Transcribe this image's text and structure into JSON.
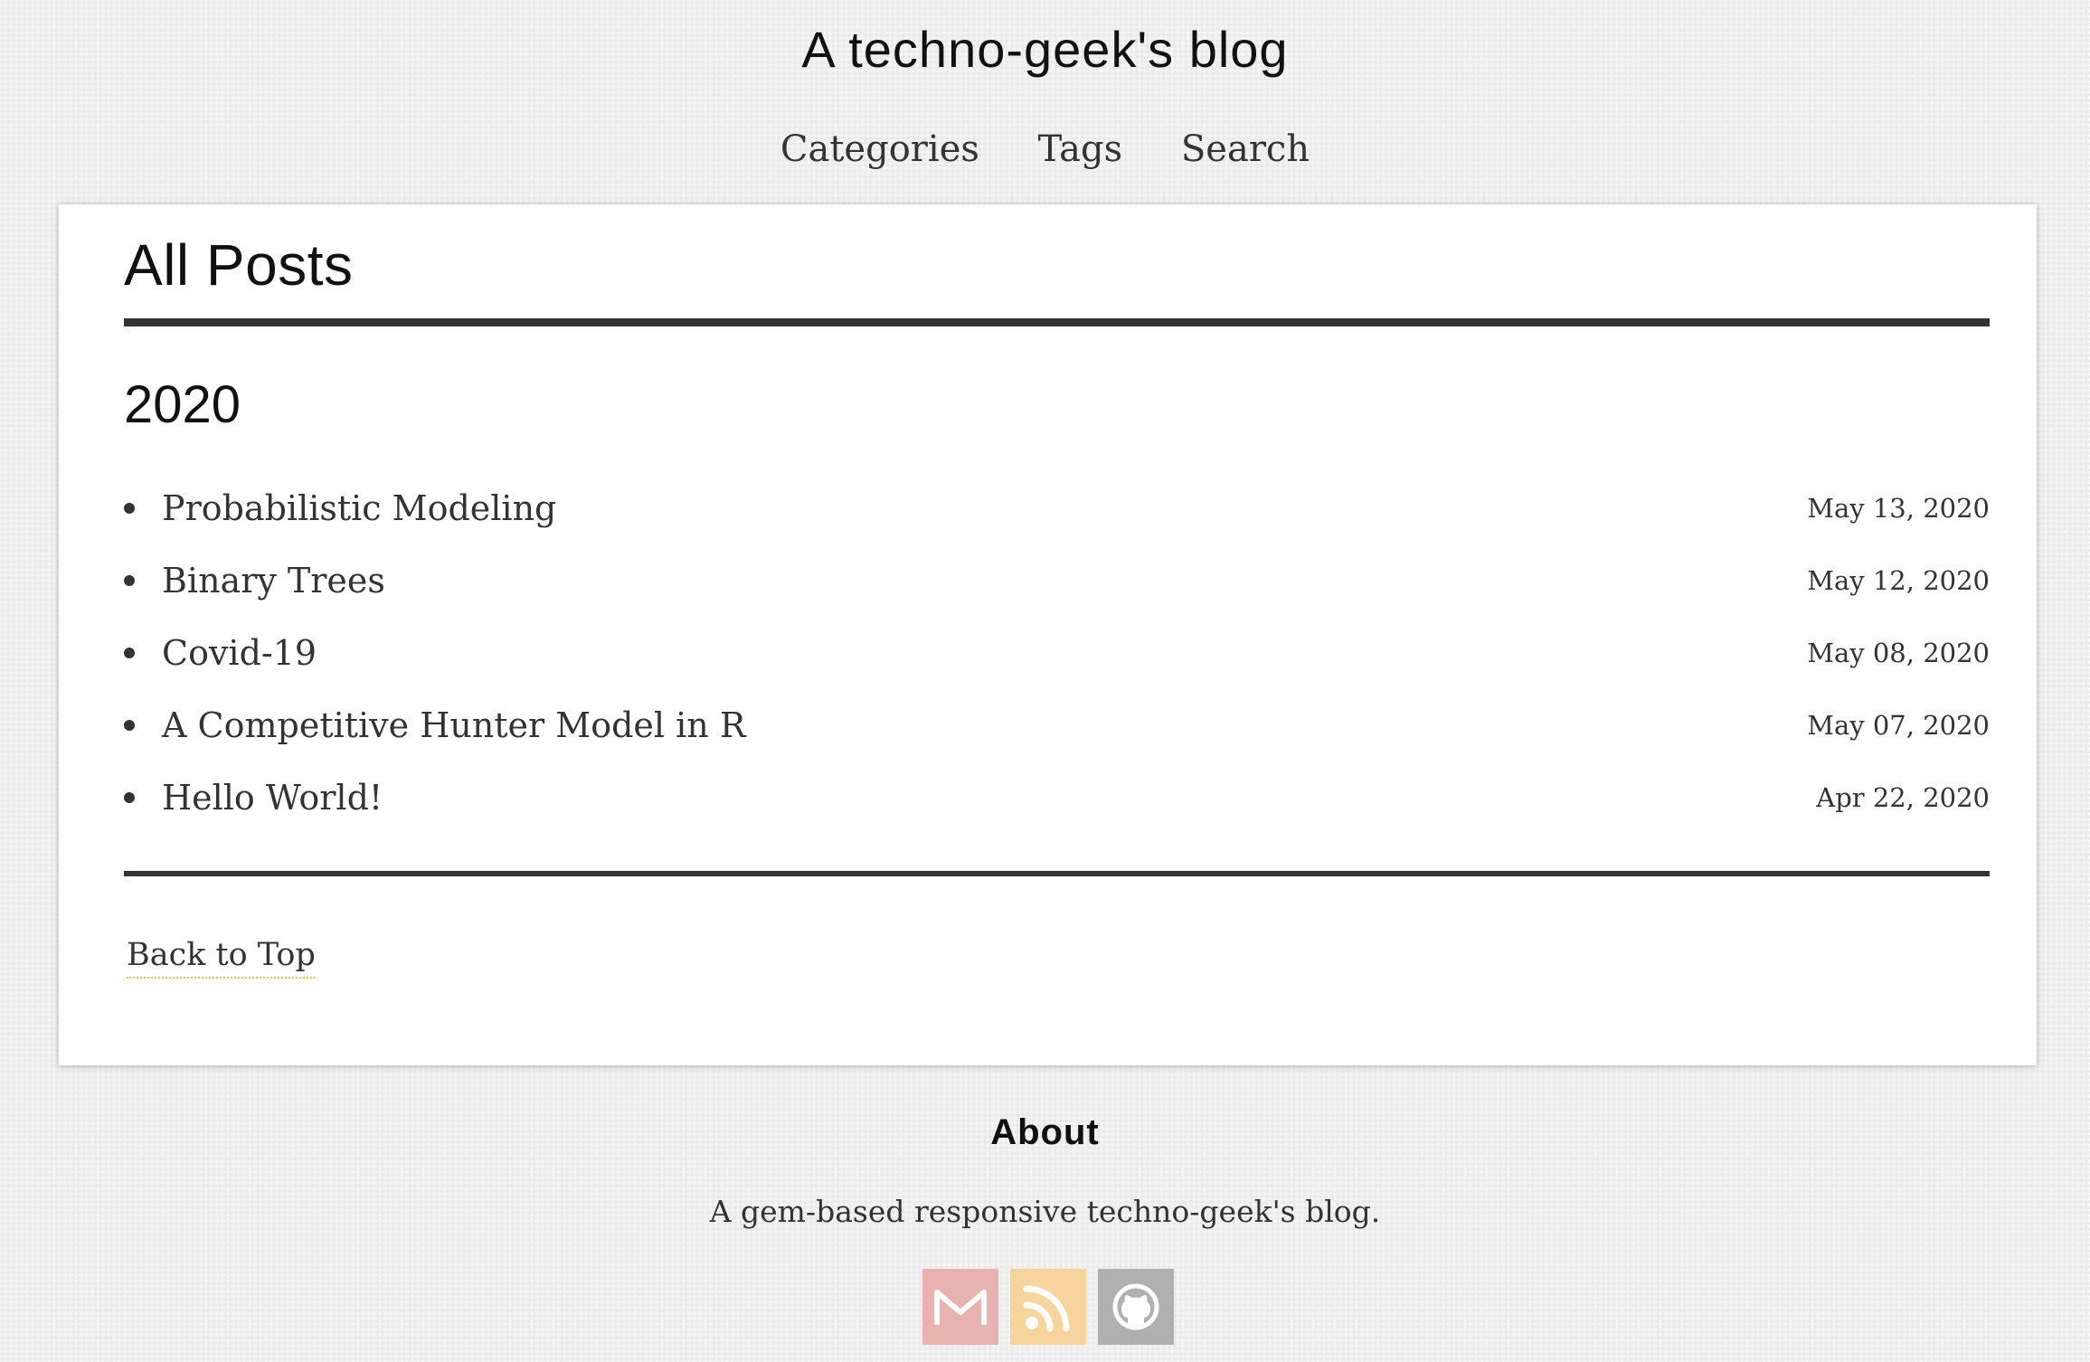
{
  "site": {
    "title": "A techno-geek's blog"
  },
  "nav": {
    "items": [
      {
        "label": "Categories"
      },
      {
        "label": "Tags"
      },
      {
        "label": "Search"
      }
    ]
  },
  "main": {
    "title": "All Posts",
    "year": "2020",
    "posts": [
      {
        "title": "Probabilistic Modeling",
        "date": "May 13, 2020"
      },
      {
        "title": "Binary Trees",
        "date": "May 12, 2020"
      },
      {
        "title": "Covid-19",
        "date": "May 08, 2020"
      },
      {
        "title": "A Competitive Hunter Model in R",
        "date": "May 07, 2020"
      },
      {
        "title": "Hello World!",
        "date": "Apr 22, 2020"
      }
    ],
    "back_to_top": "Back to Top"
  },
  "footer": {
    "about_title": "About",
    "about_text": "A gem-based responsive techno-geek's blog.",
    "socials": [
      {
        "icon": "mail-icon",
        "color": "#e8b2ae"
      },
      {
        "icon": "rss-icon",
        "color": "#f7d49c"
      },
      {
        "icon": "github-icon",
        "color": "#b0b0b0"
      }
    ]
  },
  "colors": {
    "background": "#efefef",
    "card": "#ffffff",
    "text": "#333333",
    "heading": "#111111",
    "link_underline": "#f0c040"
  }
}
